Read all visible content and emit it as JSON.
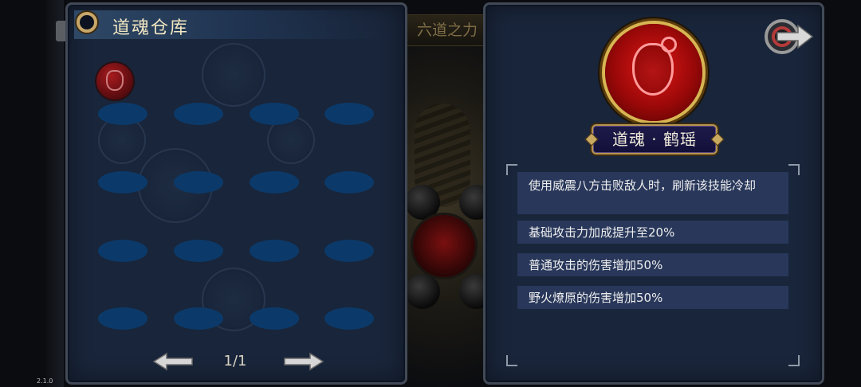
{
  "background": {
    "banner_label": "六道之力"
  },
  "warehouse": {
    "title": "道魂仓库",
    "page_indicator": "1/1",
    "slot_rows": 4,
    "slot_cols": 4,
    "occupied_slots": 1
  },
  "detail": {
    "soul_name": "道魂 · 鹤瑶",
    "effects": [
      "使用威震八方击败敌人时，刷新该技能冷却",
      "基础攻击力加成提升至20%",
      "普通攻击的伤害增加50%",
      "野火燎原的伤害增加50%"
    ]
  },
  "version": "2.1.0",
  "colors": {
    "panel": "#19253a",
    "slot": "#0b3a6a",
    "effect_row": "#28375a",
    "orb_red": "#c01a1a",
    "gold": "#c8a86a"
  }
}
